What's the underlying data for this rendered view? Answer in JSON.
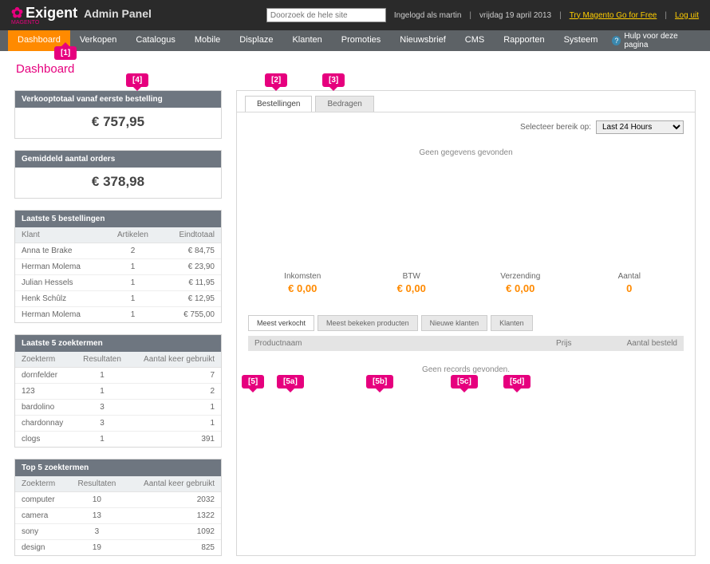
{
  "header": {
    "brand": "Exigent",
    "brand_sub": "MAGENTO",
    "panel_title": "Admin Panel",
    "search_placeholder": "Doorzoek de hele site",
    "logged_in_prefix": "Ingelogd als",
    "logged_in_user": "martin",
    "date": "vrijdag 19 april 2013",
    "try_link": "Try Magento Go for Free",
    "logout": "Log uit"
  },
  "menu": {
    "items": [
      "Dashboard",
      "Verkopen",
      "Catalogus",
      "Mobile",
      "Displaze",
      "Klanten",
      "Promoties",
      "Nieuwsbrief",
      "CMS",
      "Rapporten",
      "Systeem"
    ],
    "active_index": 0,
    "help_label": "Hulp voor deze pagina"
  },
  "page_title": "Dashboard",
  "callouts": {
    "c1": "[1]",
    "c2": "[2]",
    "c3": "[3]",
    "c4": "[4]",
    "c5": "[5]",
    "c5a": "[5a]",
    "c5b": "[5b]",
    "c5c": "[5c]",
    "c5d": "[5d]"
  },
  "left": {
    "total_box": {
      "title": "Verkooptotaal vanaf eerste bestelling",
      "value": "€ 757,95"
    },
    "avg_box": {
      "title": "Gemiddeld aantal orders",
      "value": "€ 378,98"
    },
    "orders": {
      "title": "Laatste 5 bestellingen",
      "cols": [
        "Klant",
        "Artikelen",
        "Eindtotaal"
      ],
      "rows": [
        {
          "klant": "Anna te Brake",
          "art": "2",
          "tot": "€ 84,75"
        },
        {
          "klant": "Herman Molema",
          "art": "1",
          "tot": "€ 23,90"
        },
        {
          "klant": "Julian Hessels",
          "art": "1",
          "tot": "€ 11,95"
        },
        {
          "klant": "Henk Schûlz",
          "art": "1",
          "tot": "€ 12,95"
        },
        {
          "klant": "Herman Molema",
          "art": "1",
          "tot": "€ 755,00"
        }
      ]
    },
    "last_search": {
      "title": "Laatste 5 zoektermen",
      "cols": [
        "Zoekterm",
        "Resultaten",
        "Aantal keer gebruikt"
      ],
      "rows": [
        {
          "term": "dornfelder",
          "res": "1",
          "cnt": "7"
        },
        {
          "term": "123",
          "res": "1",
          "cnt": "2"
        },
        {
          "term": "bardolino",
          "res": "3",
          "cnt": "1"
        },
        {
          "term": "chardonnay",
          "res": "3",
          "cnt": "1"
        },
        {
          "term": "clogs",
          "res": "1",
          "cnt": "391"
        }
      ]
    },
    "top_search": {
      "title": "Top 5 zoektermen",
      "cols": [
        "Zoekterm",
        "Resultaten",
        "Aantal keer gebruikt"
      ],
      "rows": [
        {
          "term": "computer",
          "res": "10",
          "cnt": "2032"
        },
        {
          "term": "camera",
          "res": "13",
          "cnt": "1322"
        },
        {
          "term": "sony",
          "res": "3",
          "cnt": "1092"
        },
        {
          "term": "design",
          "res": "19",
          "cnt": "825"
        }
      ]
    }
  },
  "right": {
    "tabs": [
      "Bestellingen",
      "Bedragen"
    ],
    "active_tab": 0,
    "range_label": "Selecteer bereik op:",
    "range_value": "Last 24 Hours",
    "empty_text": "Geen gegevens gevonden",
    "metrics": [
      {
        "label": "Inkomsten",
        "value": "€ 0,00"
      },
      {
        "label": "BTW",
        "value": "€ 0,00"
      },
      {
        "label": "Verzending",
        "value": "€ 0,00"
      },
      {
        "label": "Aantal",
        "value": "0"
      }
    ],
    "lower_tabs": [
      "Meest verkocht",
      "Meest bekeken producten",
      "Nieuwe klanten",
      "Klanten"
    ],
    "lower_active": 0,
    "product_cols": [
      "Productnaam",
      "Prijs",
      "Aantal besteld"
    ],
    "no_records": "Geen records gevonden."
  },
  "chart_data": {
    "type": "bar",
    "title": "Bestellingen — Last 24 Hours",
    "categories": [],
    "values": [],
    "note": "Geen gegevens gevonden"
  }
}
